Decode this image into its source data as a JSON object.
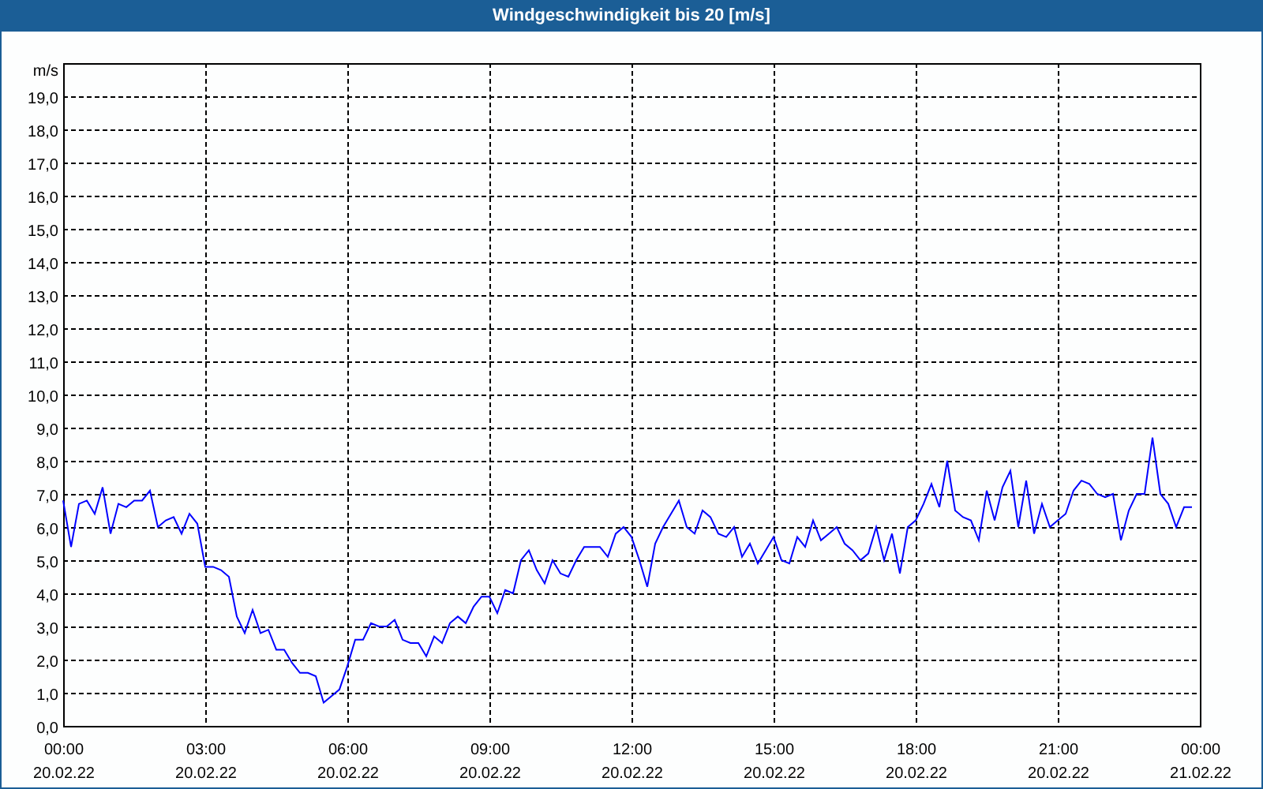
{
  "window": {
    "title": "Windgeschwindigkeit bis 20 [m/s]"
  },
  "chart": {
    "chart_data": {
      "type": "line",
      "grid": true,
      "ylabel": "m/s",
      "ylim": [
        0,
        20
      ],
      "yticks": [
        {
          "value": 0,
          "label": "0,0"
        },
        {
          "value": 1,
          "label": "1,0"
        },
        {
          "value": 2,
          "label": "2,0"
        },
        {
          "value": 3,
          "label": "3,0"
        },
        {
          "value": 4,
          "label": "4,0"
        },
        {
          "value": 5,
          "label": "5,0"
        },
        {
          "value": 6,
          "label": "6,0"
        },
        {
          "value": 7,
          "label": "7,0"
        },
        {
          "value": 8,
          "label": "8,0"
        },
        {
          "value": 9,
          "label": "9,0"
        },
        {
          "value": 10,
          "label": "10,0"
        },
        {
          "value": 11,
          "label": "11,0"
        },
        {
          "value": 12,
          "label": "12,0"
        },
        {
          "value": 13,
          "label": "13,0"
        },
        {
          "value": 14,
          "label": "14,0"
        },
        {
          "value": 15,
          "label": "15,0"
        },
        {
          "value": 16,
          "label": "16,0"
        },
        {
          "value": 17,
          "label": "17,0"
        },
        {
          "value": 18,
          "label": "18,0"
        },
        {
          "value": 19,
          "label": "19,0"
        }
      ],
      "categories": [
        "00:00\n20.02.22",
        null,
        null,
        null,
        null,
        null,
        null,
        null,
        null,
        null,
        null,
        null,
        null,
        null,
        null,
        null,
        null,
        null,
        "03:00\n20.02.22",
        null,
        null,
        null,
        null,
        null,
        null,
        null,
        null,
        null,
        null,
        null,
        null,
        null,
        null,
        null,
        null,
        null,
        "06:00\n20.02.22",
        null,
        null,
        null,
        null,
        null,
        null,
        null,
        null,
        null,
        null,
        null,
        null,
        null,
        null,
        null,
        null,
        null,
        "09:00\n20.02.22",
        null,
        null,
        null,
        null,
        null,
        null,
        null,
        null,
        null,
        null,
        null,
        null,
        null,
        null,
        null,
        null,
        null,
        "12:00\n20.02.22",
        null,
        null,
        null,
        null,
        null,
        null,
        null,
        null,
        null,
        null,
        null,
        null,
        null,
        null,
        null,
        null,
        null,
        "15:00\n20.02.22",
        null,
        null,
        null,
        null,
        null,
        null,
        null,
        null,
        null,
        null,
        null,
        null,
        null,
        null,
        null,
        null,
        null,
        "18:00\n20.02.22",
        null,
        null,
        null,
        null,
        null,
        null,
        null,
        null,
        null,
        null,
        null,
        null,
        null,
        null,
        null,
        null,
        null,
        "21:00\n20.02.22",
        null,
        null,
        null,
        null,
        null,
        null,
        null,
        null,
        null,
        null,
        null,
        null,
        null,
        null,
        null,
        null,
        null,
        "00:00\n21.02.22"
      ],
      "series": [
        {
          "color": "#0000ff",
          "values": [
            6.8,
            5.4,
            6.7,
            6.8,
            6.4,
            7.2,
            5.8,
            6.7,
            6.6,
            6.8,
            6.8,
            7.1,
            6.0,
            6.2,
            6.3,
            5.8,
            6.4,
            6.1,
            4.8,
            4.8,
            4.7,
            4.5,
            3.3,
            2.8,
            3.5,
            2.8,
            2.9,
            2.3,
            2.3,
            1.9,
            1.6,
            1.6,
            1.5,
            0.7,
            0.9,
            1.1,
            1.8,
            2.6,
            2.6,
            3.1,
            3.0,
            3.0,
            3.2,
            2.6,
            2.5,
            2.5,
            2.1,
            2.7,
            2.5,
            3.1,
            3.3,
            3.1,
            3.6,
            3.9,
            3.9,
            3.4,
            4.1,
            4.0,
            5.0,
            5.3,
            4.7,
            4.3,
            5.0,
            4.6,
            4.5,
            5.0,
            5.4,
            5.4,
            5.4,
            5.1,
            5.8,
            6.0,
            5.7,
            5.0,
            4.2,
            5.5,
            6.0,
            6.4,
            6.8,
            6.0,
            5.8,
            6.5,
            6.3,
            5.8,
            5.7,
            6.0,
            5.1,
            5.5,
            4.9,
            5.3,
            5.7,
            5.0,
            4.9,
            5.7,
            5.4,
            6.2,
            5.6,
            5.8,
            6.0,
            5.5,
            5.3,
            5.0,
            5.2,
            6.0,
            5.0,
            5.8,
            4.6,
            6.0,
            6.2,
            6.7,
            7.3,
            6.6,
            8.0,
            6.5,
            6.3,
            6.2,
            5.6,
            7.1,
            6.2,
            7.2,
            7.7,
            6.0,
            7.4,
            5.8,
            6.7,
            6.0,
            6.2,
            6.4,
            7.1,
            7.4,
            7.3,
            7.0,
            6.9,
            7.0,
            5.6,
            6.5,
            7.0,
            7.0,
            8.7,
            7.0,
            6.7,
            6.0,
            6.6,
            6.6,
            null
          ]
        }
      ]
    }
  }
}
